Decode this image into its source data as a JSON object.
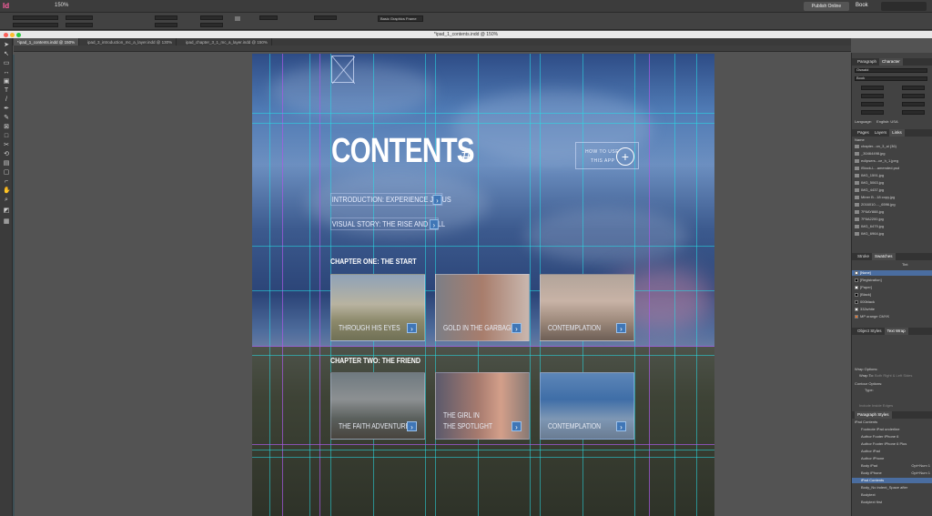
{
  "app": {
    "zoom": "150%",
    "publish_label": "Publish Online",
    "workspace": "Book"
  },
  "control": {
    "preset": "Basic Graphics Frame"
  },
  "doc_tabs": [
    {
      "label": "*ipad_1_contents.indd @ 150%"
    },
    {
      "label": "ipad_3_introduction_mc_a_layer.indd @ 130%"
    },
    {
      "label": "ipad_chapter_3_1_mc_a_layer.indd @ 150%"
    }
  ],
  "window_title": "*ipad_1_contents.indd @ 150%",
  "page": {
    "title": "CONTENTS",
    "title_hash": "#",
    "howto_line1": "HOW TO USE",
    "howto_line2": "THIS APP",
    "howto_plus": "+",
    "intro_links": [
      {
        "label": "INTRODUCTION: EXPERIENCE JESUS",
        "arrow": "›"
      },
      {
        "label": "VISUAL STORY: THE RISE AND FALL",
        "arrow": "›"
      }
    ],
    "chapter_one": "CHAPTER ONE: THE START",
    "chapter_two": "CHAPTER TWO: THE FRIEND",
    "cards": [
      {
        "caption": "THROUGH HIS EYES",
        "arrow": "›"
      },
      {
        "caption": "GOLD IN THE GARBAGE",
        "arrow": "›"
      },
      {
        "caption": "CONTEMPLATION",
        "arrow": "›"
      },
      {
        "caption": "THE FAITH ADVENTURE",
        "arrow": "›"
      },
      {
        "caption_line1": "THE GIRL IN",
        "caption_line2": "THE SPOTLIGHT",
        "arrow": "›"
      },
      {
        "caption": "CONTEMPLATION",
        "arrow": "›"
      }
    ]
  },
  "panels": {
    "paragraph_tab": "Paragraph",
    "character_tab": "Character",
    "font": "Oswald",
    "style": "Book",
    "language_label": "Language:",
    "language": "English: USA",
    "pages_tab": "Pages",
    "layers_tab": "Layers",
    "links_tab": "Links",
    "links_name_header": "Name",
    "links": [
      "chapter...on_3_ai (36)",
      "_30464498.jpg",
      "eclipsers...ce_h_1.jpeg",
      "iStock-L...amended.psd",
      "IMG_1591.jpg",
      "IMG_5063.jpg",
      "IMG_4437.jpg",
      "Miner B...18 copy.jpg",
      "2016010...._6596.jpg",
      "7F6AY888.jpg",
      "7F6A2200.jpg",
      "IMG_6479.jpg",
      "IMG_6964.jpg"
    ],
    "stroke_tab": "Stroke",
    "swatches_tab": "Swatches",
    "tint_label": "Tint",
    "swatches": [
      {
        "name": "[None]",
        "color": "#ffffff"
      },
      {
        "name": "[Registration]",
        "color": "#000000"
      },
      {
        "name": "[Paper]",
        "color": "#ffffff"
      },
      {
        "name": "[Black]",
        "color": "#000000"
      },
      {
        "name": "000black",
        "color": "#111111"
      },
      {
        "name": "332white",
        "color": "#f2f2f2"
      },
      {
        "name": "MP orange CMYK",
        "color": "#e8742a"
      }
    ],
    "object_styles_tab": "Object Styles",
    "text_wrap_tab": "Text Wrap",
    "wrap_options_label": "Wrap Options:",
    "wrap_to_label": "Wrap To:",
    "wrap_to_value": "Both Right & Left Sides",
    "contour_options_label": "Contour Options:",
    "type_label": "Type:",
    "include_inside_edges": "Include Inside Edges",
    "paragraph_styles_tab": "Paragraph Styles",
    "pstyles_group": "iPad Contents",
    "paragraph_styles": [
      {
        "name": "Footnote iPad underline",
        "shortcut": ""
      },
      {
        "name": "Author Footer iPhone 6",
        "shortcut": ""
      },
      {
        "name": "Author Footer iPhone 6 Plus",
        "shortcut": ""
      },
      {
        "name": "Author iPad",
        "shortcut": ""
      },
      {
        "name": "Author iPhone",
        "shortcut": ""
      },
      {
        "name": "Body iPad",
        "shortcut": "Opt+Num 1"
      },
      {
        "name": "Body iPhone",
        "shortcut": "Opt+Num 1"
      },
      {
        "name": "iPad Contents",
        "shortcut": ""
      },
      {
        "name": "Body_No indent_Space after",
        "shortcut": ""
      },
      {
        "name": "Bodytext",
        "shortcut": ""
      },
      {
        "name": "Bodytext first",
        "shortcut": ""
      }
    ]
  }
}
